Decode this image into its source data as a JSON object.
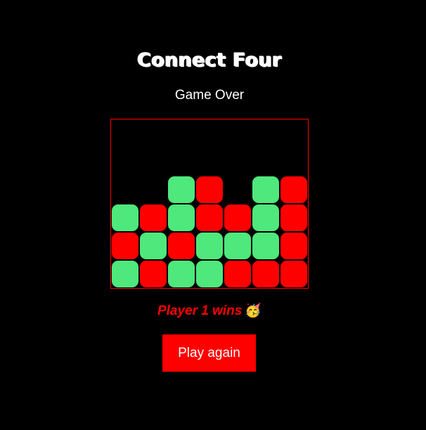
{
  "game": {
    "title": "Connect Four",
    "status": "Game Over",
    "result": "Player 1 wins",
    "result_emoji": "🥳",
    "play_again_label": "Play again"
  },
  "colors": {
    "player1": "#ff0000",
    "player2": "#4ee87c",
    "board_border": "#ff0000",
    "background": "#000000",
    "button_bg": "#ff0000"
  },
  "board": {
    "rows": 6,
    "cols": 7,
    "cells": [
      [
        0,
        0,
        0,
        0,
        0,
        0,
        0
      ],
      [
        0,
        0,
        0,
        0,
        0,
        0,
        0
      ],
      [
        0,
        0,
        2,
        1,
        0,
        2,
        1
      ],
      [
        2,
        1,
        2,
        1,
        1,
        2,
        1
      ],
      [
        1,
        2,
        1,
        2,
        2,
        2,
        1
      ],
      [
        2,
        1,
        2,
        2,
        1,
        1,
        1
      ]
    ]
  }
}
